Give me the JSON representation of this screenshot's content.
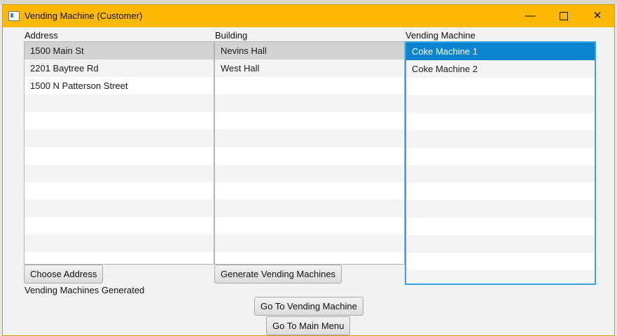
{
  "window": {
    "title": "Vending Machine (Customer)",
    "minimize_glyph": "—",
    "close_glyph": "✕"
  },
  "colors": {
    "titlebar": "#ffb900",
    "selection": "#0a84d0",
    "focus_border": "#34a4dc"
  },
  "address": {
    "label": "Address",
    "items": [
      "1500 Main St",
      "2201 Baytree Rd",
      "1500 N Patterson Street"
    ],
    "selected": "1500 Main St"
  },
  "building": {
    "label": "Building",
    "items": [
      "Nevins Hall",
      "West Hall"
    ],
    "selected": "Nevins Hall"
  },
  "vending": {
    "label": "Vending Machine",
    "items": [
      "Coke Machine 1",
      "Coke Machine 2"
    ],
    "selected": "Coke Machine 1"
  },
  "buttons": {
    "choose_address": "Choose Address",
    "generate": "Generate Vending Machines",
    "go_to_vm": "Go To Vending Machine",
    "main_menu": "Go To Main Menu"
  },
  "status": "Vending Machines Generated"
}
